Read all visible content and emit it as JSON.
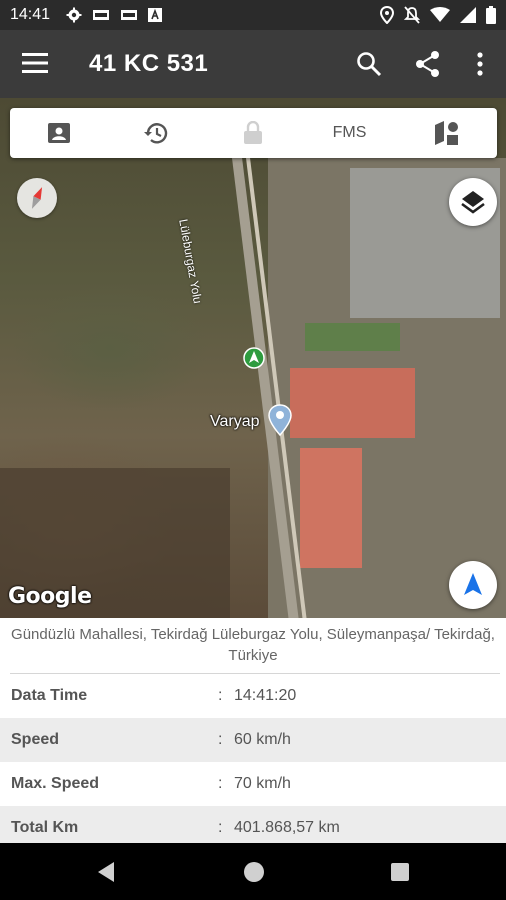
{
  "status_bar": {
    "time": "14:41",
    "left_icons": [
      "settings-icon",
      "sim-icon",
      "sim-icon",
      "font-a-icon"
    ],
    "right_icons": [
      "location-pin-icon",
      "mute-icon",
      "wifi-icon",
      "signal-icon",
      "battery-icon"
    ]
  },
  "app_bar": {
    "title": "41 KC 531",
    "actions": [
      "search-icon",
      "share-icon",
      "more-vert-icon"
    ]
  },
  "tabs": [
    {
      "name": "contact-card-icon",
      "label": ""
    },
    {
      "name": "history-icon",
      "label": ""
    },
    {
      "name": "lock-icon",
      "label": "",
      "disabled": true
    },
    {
      "name": "fms-tab",
      "label": "FMS"
    },
    {
      "name": "map-shapes-icon",
      "label": ""
    }
  ],
  "map": {
    "provider_label": "Google",
    "road_label": "Lüleburgaz Yolu",
    "poi_label": "Varyap",
    "colors": {
      "nav_arrow": "#1a73e8",
      "vehicle_marker": "#2e9b3f"
    }
  },
  "address": "Gündüzlü Mahallesi, Tekirdağ Lüleburgaz Yolu, Süleymanpaşa/ Tekirdağ, Türkiye",
  "details": [
    {
      "label": "Data Time",
      "value": "14:41:20"
    },
    {
      "label": "Speed",
      "value": "60 km/h"
    },
    {
      "label": "Max. Speed",
      "value": "70 km/h"
    },
    {
      "label": "Total Km",
      "value": "401.868,57 km"
    }
  ],
  "separator": ":"
}
